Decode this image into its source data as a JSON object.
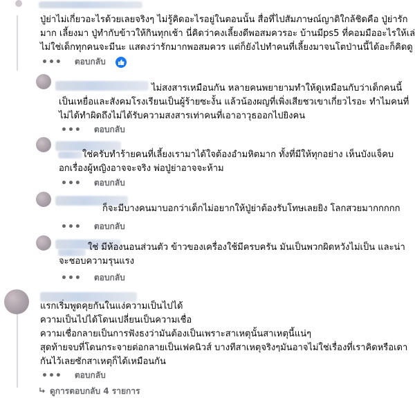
{
  "comments": [
    {
      "lines": [
        "ปู่ย่าไม่เกี่ยวอะไรด้วยเลยจริงๆ ไม่รู้คิดอะไรอยู่ในตอนนั้น สื่อที่ไปสัมภาษณ์ญาติใกล้ชิดคือ ปู่ย่ารัก",
        "มาก เลี้ยงมา ปู่ทำกับข้าวให้กินทุกเช้า นี่คิดว่าคงเลี้ยงดีพอสมควรอะ บ้านมีps5 ที่คอมมืออะไรให้เล่น",
        "ไม่ใช่เด็กทุกคนจะมีนะ แสดงว่ารักมากพอสมควร แต่ก็ยังไปทำคนที่เลี้ยงมาจนโตป่านนี้ได้อะก็คิดดู"
      ],
      "more": "•••",
      "reply": "ตอบกลับ"
    },
    {
      "lines": [
        "ไม่สงสารเหมือนกัน หลายคนพยายามทำให้ดูเหมือนกับว่าเด็กคนนี้",
        "เป็นเหยื่อและสังคมโรงเรียนเป็นผู้ร้ายซะงั้น แล้วน้องผญที่เพิ่งเสียชวเขาเกี่ยวไรอะ ทำไมคนที่",
        "ไม่ได้ทำผิดถึงไม่ได้รับความสงสารเท่าคนที่เอาอาวุธออกไปยิงคน"
      ],
      "more": "•••",
      "reply": "ตอบกลับ"
    },
    {
      "lines": [
        "ใช่ครับทำร้ายคนที่เลี้ยงเรามาได้ใจต้องอำมหิตมาก ทั้งที่มีให้ทุกอย่าง เห็นบังแจ็คบ",
        "อกเรื่องผู้หญิงอาจจะจริง พ่อปู่ย่าอาจจะห้าม"
      ],
      "more": "•••",
      "reply": "ตอบกลับ"
    },
    {
      "lines": [
        "ก็จะมีบางคนมาบอกว่าเด็กไม่อยากให้ปู่ย่าต้องรับโทษเลยยิง โลกสวยมากกกกก"
      ],
      "more": "•••",
      "reply": "ตอบกลับ"
    },
    {
      "lines": [
        "ใช่ มีห้องนอนส่วนตัว ข้าวของเครื่องใช้มีครบครัน มันเป็นพวกผิดหวังไม่เป็น และน่า",
        "จะชอบความรุนแรง"
      ],
      "more": "•••",
      "reply": "ตอบกลับ"
    },
    {
      "lines": [
        "แรกเริ่มพูดคุยกันในแง่ความเป็นไปได้",
        "ความเป็นไปได้โดนเปลี่ยนเป็นความเชื่อ",
        "ความเชื่อกลายเป็นการฟังธงว่ามันต้องเป็นเพราะสาเหตุนั้นสาเหตุนี้แน่ๆ",
        "สุดท้ายจบที่โดนกระจายต่อกลายเป็นเฟคนิวส์ บางทีสาเหตุจริงๆมันอาจไม่ใช่เรื่องที่เราคิดหรือเดา",
        "กันไว้เลยซักสาเหตุก็ได้เหมือนกัน"
      ],
      "more": "•••",
      "reply": "ตอบกลับ"
    }
  ],
  "view_replies": "ดูการตอบกลับ 4 รายการ",
  "colors": {
    "like_blue": "#1877f2",
    "meta_gray": "#65676b"
  },
  "icons": {
    "like": "thumbs-up-icon",
    "more": "more-dots-icon",
    "expand": "reply-arrow-icon"
  }
}
